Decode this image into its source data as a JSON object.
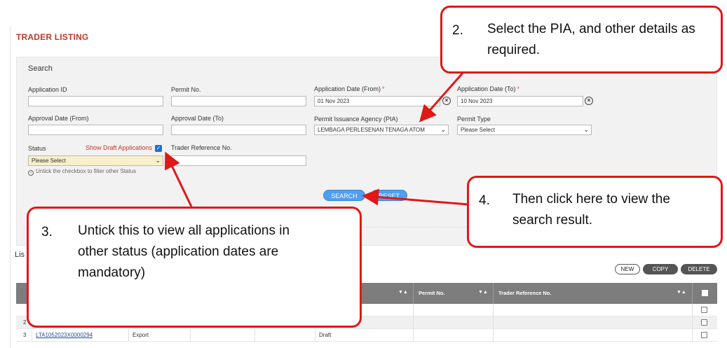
{
  "page": {
    "title": "TRADER LISTING",
    "search_heading": "Search",
    "list_heading": "Lis"
  },
  "search": {
    "application_id": {
      "label": "Application ID",
      "value": ""
    },
    "permit_no": {
      "label": "Permit No.",
      "value": ""
    },
    "application_date_from": {
      "label": "Application Date (From)",
      "required_mark": "*",
      "value": "01 Nov 2023"
    },
    "application_date_to": {
      "label": "Application Date (To)",
      "required_mark": "*",
      "value": "10 Nov 2023"
    },
    "approval_date_from": {
      "label": "Approval Date (From)",
      "value": ""
    },
    "approval_date_to": {
      "label": "Approval Date (To)",
      "value": ""
    },
    "pia": {
      "label": "Permit Issuance Agency (PIA)",
      "value": "LEMBAGA PERLESENAN TENAGA ATOM"
    },
    "permit_type": {
      "label": "Permit Type",
      "value": "Please Select"
    },
    "status": {
      "label": "Status",
      "value": "Please Select"
    },
    "show_draft": {
      "label": "Show Draft Applications",
      "checked": true
    },
    "trader_reference_no": {
      "label": "Trader Reference No.",
      "value": ""
    },
    "hint": "Untick the checkbox to filter other Status",
    "search_button": "SEARCH",
    "reset_button": "RESET"
  },
  "toolbar": {
    "new_label": "NEW",
    "copy_label": "COPY",
    "delete_label": "DELETE"
  },
  "table": {
    "columns": [
      "Permit No.",
      "Trader Reference No."
    ],
    "sort_glyph": "▼▲",
    "rows": [
      {
        "no": "",
        "application_id": "",
        "type": "",
        "status": ""
      },
      {
        "no": "2",
        "application_id": "",
        "type": "",
        "status": ""
      },
      {
        "no": "3",
        "application_id": "LTA1052023X0000294",
        "type": "Export",
        "status": "Draft"
      }
    ]
  },
  "callouts": [
    {
      "num": "2.",
      "text": "Select the PIA, and other details as required."
    },
    {
      "num": "3.",
      "text": "Untick this to view all applications in other status (application dates are mandatory)"
    },
    {
      "num": "4.",
      "text": "Then click here to view the search result."
    }
  ],
  "colors": {
    "title_red": "#c0392b",
    "callout_border": "#e01818",
    "button_blue": "#4f9ef0",
    "table_header": "#7d7d7d"
  }
}
